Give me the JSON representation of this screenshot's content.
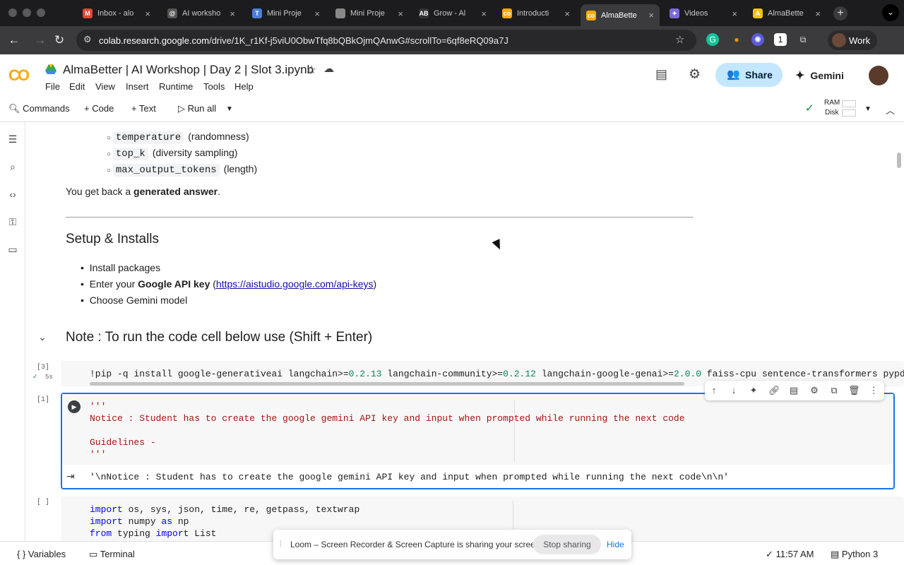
{
  "browser": {
    "tabs": [
      {
        "label": "Inbox - alo",
        "icon": "gmail-icon",
        "color": "#ea4335",
        "glyph": "M"
      },
      {
        "label": "AI worksho",
        "icon": "openai-icon",
        "color": "#555555",
        "glyph": "@"
      },
      {
        "label": "Mini Proje",
        "icon": "notion-icon",
        "color": "#4a7fd4",
        "glyph": "T"
      },
      {
        "label": "Mini Proje",
        "icon": "globe-icon",
        "color": "#888888",
        "glyph": ""
      },
      {
        "label": "Grow - Al",
        "icon": "ab-icon",
        "color": "#333333",
        "glyph": "AB"
      },
      {
        "label": "Introducti",
        "icon": "colab-icon",
        "color": "#f9ab00",
        "glyph": "co"
      },
      {
        "label": "AlmaBette",
        "icon": "colab-icon",
        "color": "#f9ab00",
        "glyph": "co"
      },
      {
        "label": "Videos",
        "icon": "gemini-icon",
        "color": "#7a6ad8",
        "glyph": "✦"
      },
      {
        "label": "AlmaBette",
        "icon": "almabetter-icon",
        "color": "#f4c20d",
        "glyph": "A"
      }
    ],
    "active_tab": 6,
    "url_host": "colab.research.google.com",
    "url_path": "/drive/1K_r1Kf-j5viU0ObwTfq8bQBkOjmQAnwG#scrollTo=6qf8eRQ09a7J",
    "profile": "Work"
  },
  "header": {
    "title": "AlmaBetter | AI Workshop | Day 2 | Slot 3.ipynb",
    "menu": [
      "File",
      "Edit",
      "View",
      "Insert",
      "Runtime",
      "Tools",
      "Help"
    ],
    "share_label": "Share",
    "gemini_label": "Gemini"
  },
  "toolbar": {
    "commands_label": "Commands",
    "code_label": "Code",
    "text_label": "Text",
    "runall_label": "Run all",
    "ram_label": "RAM",
    "disk_label": "Disk"
  },
  "content": {
    "param_bullets": [
      {
        "code": "temperature",
        "desc": "(randomness)"
      },
      {
        "code": "top_k",
        "desc": "(diversity sampling)"
      },
      {
        "code": "max_output_tokens",
        "desc": "(length)"
      }
    ],
    "answer_prefix": "You get back a ",
    "answer_bold": "generated answer",
    "answer_suffix": ".",
    "setup_heading": "Setup & Installs",
    "setup_bullets": {
      "item1": "Install packages",
      "item2_prefix": "Enter your ",
      "item2_bold": "Google API key",
      "item2_link": "https://aistudio.google.com/api-keys",
      "item3": "Choose Gemini model"
    },
    "note_heading": "Note : To run the code cell below use (Shift + Enter)",
    "cell1": {
      "exec": "[3]",
      "time": "5s",
      "code_parts": [
        "!pip -q install google-generativeai langchain>=",
        "0.2.13",
        " langchain-community>=",
        "0.2.12",
        " langchain-google-genai>=",
        "2.0.0",
        " faiss-cpu sentence-transformers pypdf p"
      ]
    },
    "cell2": {
      "exec": "[1]",
      "lines": [
        "'''",
        "Notice : Student has to create the google gemini API key and input when prompted while running the next code",
        "",
        "Guidelines -",
        "'''"
      ],
      "output": "'\\nNotice : Student has to create the google gemini API key and input when prompted while running the next code\\n\\n'"
    },
    "cell3": {
      "exec": "[ ]",
      "lines": [
        {
          "kw": "import",
          "rest": " os, sys, json, time, re, getpass, textwrap"
        },
        {
          "kw": "import",
          "rest": " numpy ",
          "kw2": "as",
          "rest2": " np"
        },
        {
          "kw": "from",
          "rest": " typing ",
          "kw2": "import",
          "rest2": " List"
        }
      ]
    }
  },
  "statusbar": {
    "variables_label": "Variables",
    "terminal_label": "Terminal",
    "time": "11:57 AM",
    "runtime": "Python 3"
  },
  "loom": {
    "message": "Loom – Screen Recorder & Screen Capture is sharing your screen.",
    "stop_label": "Stop sharing",
    "hide_label": "Hide"
  }
}
